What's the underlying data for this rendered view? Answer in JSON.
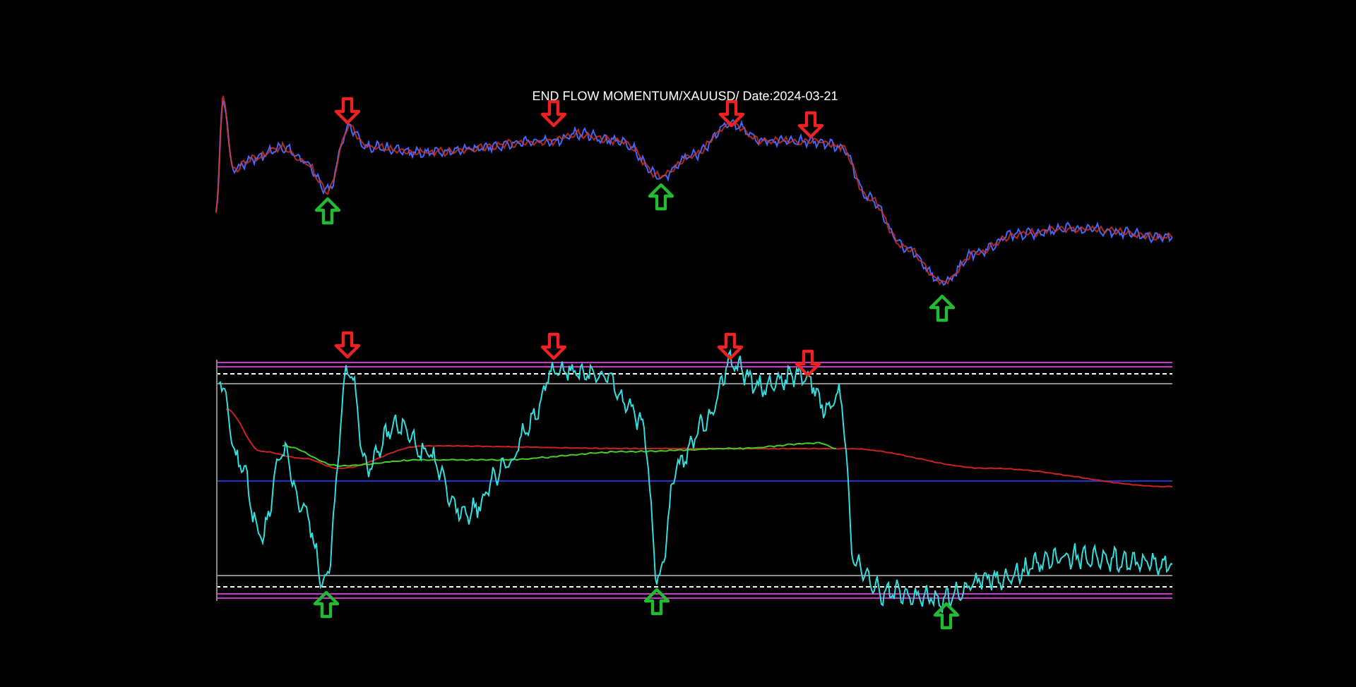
{
  "chart": {
    "title": "END FLOW MOMENTUM/XAUUSD/ Date:2024-03-21"
  }
}
